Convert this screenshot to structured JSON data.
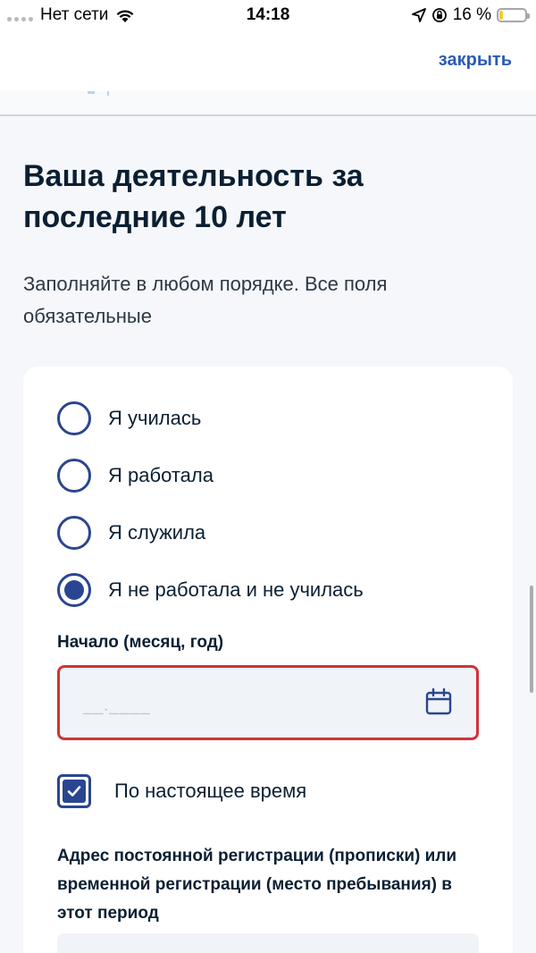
{
  "status_bar": {
    "carrier": "Нет сети",
    "time": "14:18",
    "battery_percent": "16 %",
    "battery_level": 0.16
  },
  "header": {
    "close_label": "закрыть"
  },
  "main": {
    "title": "Ваша деятельность за последние 10 лет",
    "subtitle": "Заполняйте в любом порядке. Все поля обязательные"
  },
  "form": {
    "activity_options": [
      {
        "label": "Я училась",
        "selected": false
      },
      {
        "label": "Я работала",
        "selected": false
      },
      {
        "label": "Я служила",
        "selected": false
      },
      {
        "label": "Я не работала и не училась",
        "selected": true
      }
    ],
    "start_label": "Начало (месяц, год)",
    "start_placeholder": "__.____",
    "start_value": "",
    "to_present_label": "По настоящее время",
    "to_present_checked": true,
    "address_label": "Адрес постоянной регистрации (прописки) или временной регистрации (место пребывания) в этот период"
  },
  "icons": {
    "wifi": "wifi-icon",
    "location": "location-arrow-icon",
    "rotation_lock": "rotation-lock-icon",
    "battery": "battery-icon",
    "calendar": "calendar-icon",
    "check": "check-icon"
  },
  "colors": {
    "accent": "#2a4591",
    "link": "#2a5bb8",
    "error": "#d0333a",
    "background": "#f5f7fa",
    "battery_fill": "#f5cc2a"
  }
}
